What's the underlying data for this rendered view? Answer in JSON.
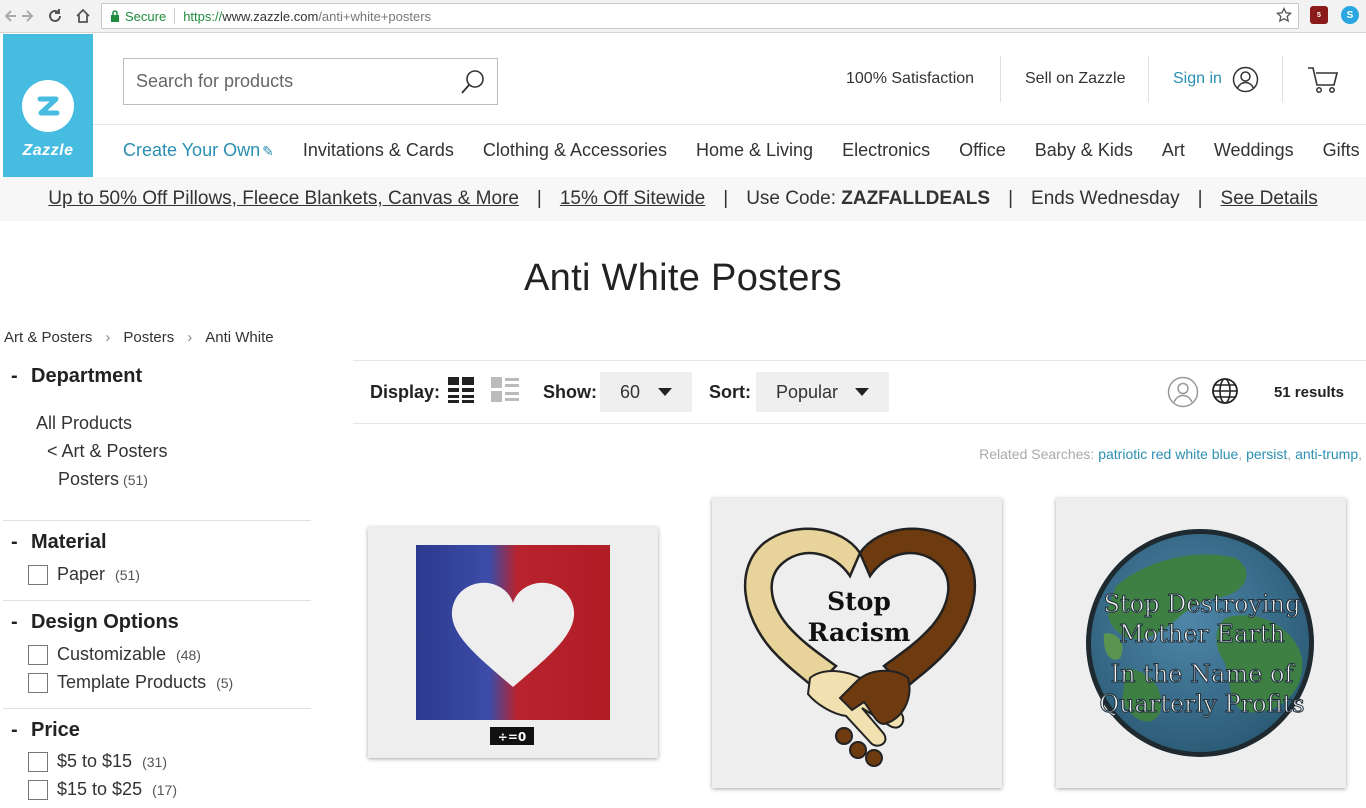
{
  "browser": {
    "secure_label": "Secure",
    "url_scheme": "https://",
    "url_host": "www.zazzle.com",
    "url_path": "/anti+white+posters",
    "ext_badge": "5"
  },
  "header": {
    "logo_text": "Zazzle",
    "search_placeholder": "Search for products",
    "satisfaction": "100% Satisfaction",
    "sell": "Sell on Zazzle",
    "signin": "Sign in"
  },
  "nav": {
    "create": "Create Your Own",
    "items": [
      "Invitations & Cards",
      "Clothing & Accessories",
      "Home & Living",
      "Electronics",
      "Office",
      "Baby & Kids",
      "Art",
      "Weddings",
      "Gifts"
    ]
  },
  "promo": {
    "deal1": "Up to 50% Off Pillows, Fleece Blankets, Canvas & More",
    "deal2": "15% Off Sitewide",
    "code_label": "Use Code: ",
    "code": "ZAZFALLDEALS",
    "ends": "Ends Wednesday",
    "details": "See Details",
    "sep": "|"
  },
  "page": {
    "title": "Anti White Posters",
    "breadcrumbs": [
      "Art & Posters",
      "Posters",
      "Anti White"
    ]
  },
  "filters": {
    "department": {
      "heading": "Department",
      "all": "All Products",
      "parent": "< Art & Posters",
      "current": "Posters",
      "current_count": "(51)"
    },
    "material": {
      "heading": "Material",
      "options": [
        {
          "label": "Paper",
          "count": "(51)"
        }
      ]
    },
    "design": {
      "heading": "Design Options",
      "options": [
        {
          "label": "Customizable",
          "count": "(48)"
        },
        {
          "label": "Template Products",
          "count": "(5)"
        }
      ]
    },
    "price": {
      "heading": "Price",
      "options": [
        {
          "label": "$5 to $15",
          "count": "(31)"
        },
        {
          "label": "$15 to $25",
          "count": "(17)"
        }
      ]
    },
    "dash": "-"
  },
  "toolbar": {
    "display_label": "Display:",
    "show_label": "Show:",
    "show_value": "60",
    "sort_label": "Sort:",
    "sort_value": "Popular",
    "results": "51 results"
  },
  "related": {
    "label": "Related Searches: ",
    "links": [
      "patriotic red white blue",
      "persist",
      "anti-trump"
    ]
  },
  "products": {
    "p1_badge": "÷=0",
    "p2_line1": "Stop",
    "p2_line2": "Racism",
    "p3_line1": "Stop Destroying",
    "p3_line2": "Mother Earth",
    "p3_line3": "In the Name of",
    "p3_line4": "Quarterly Profits"
  },
  "colors": {
    "brand": "#46bde0",
    "link": "#2b8fb2"
  }
}
